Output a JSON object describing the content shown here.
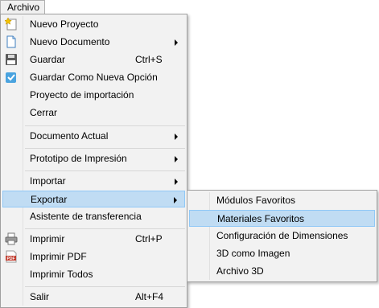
{
  "menubar": {
    "archivo": "Archivo"
  },
  "main_menu": {
    "nuevo_proyecto": "Nuevo Proyecto",
    "nuevo_documento": "Nuevo Documento",
    "guardar": "Guardar",
    "guardar_shortcut": "Ctrl+S",
    "guardar_como": "Guardar Como Nueva Opción",
    "proyecto_importacion": "Proyecto de importación",
    "cerrar": "Cerrar",
    "documento_actual": "Documento Actual",
    "prototipo_impresion": "Prototipo de Impresión",
    "importar": "Importar",
    "exportar": "Exportar",
    "asistente": "Asistente de transferencia",
    "imprimir": "Imprimir",
    "imprimir_shortcut": "Ctrl+P",
    "imprimir_pdf": "Imprimir PDF",
    "imprimir_todos": "Imprimir Todos",
    "salir": "Salir",
    "salir_shortcut": "Alt+F4"
  },
  "export_submenu": {
    "modulos_favoritos": "Módulos Favoritos",
    "materiales_favoritos": "Materiales Favoritos",
    "configuracion_dimensiones": "Configuración de Dimensiones",
    "imagen_3d": "3D como Imagen",
    "archivo_3d": "Archivo 3D"
  },
  "icons": {
    "nuevo_proyecto": "new-project-star-icon",
    "nuevo_documento": "new-document-icon",
    "guardar": "floppy-disk-icon",
    "guardar_como": "save-as-check-icon",
    "imprimir": "printer-icon",
    "imprimir_pdf": "pdf-icon"
  },
  "colors": {
    "highlight": "#c0dcf3",
    "highlight_border": "#90c8f6",
    "menu_bg": "#f2f2f2"
  }
}
